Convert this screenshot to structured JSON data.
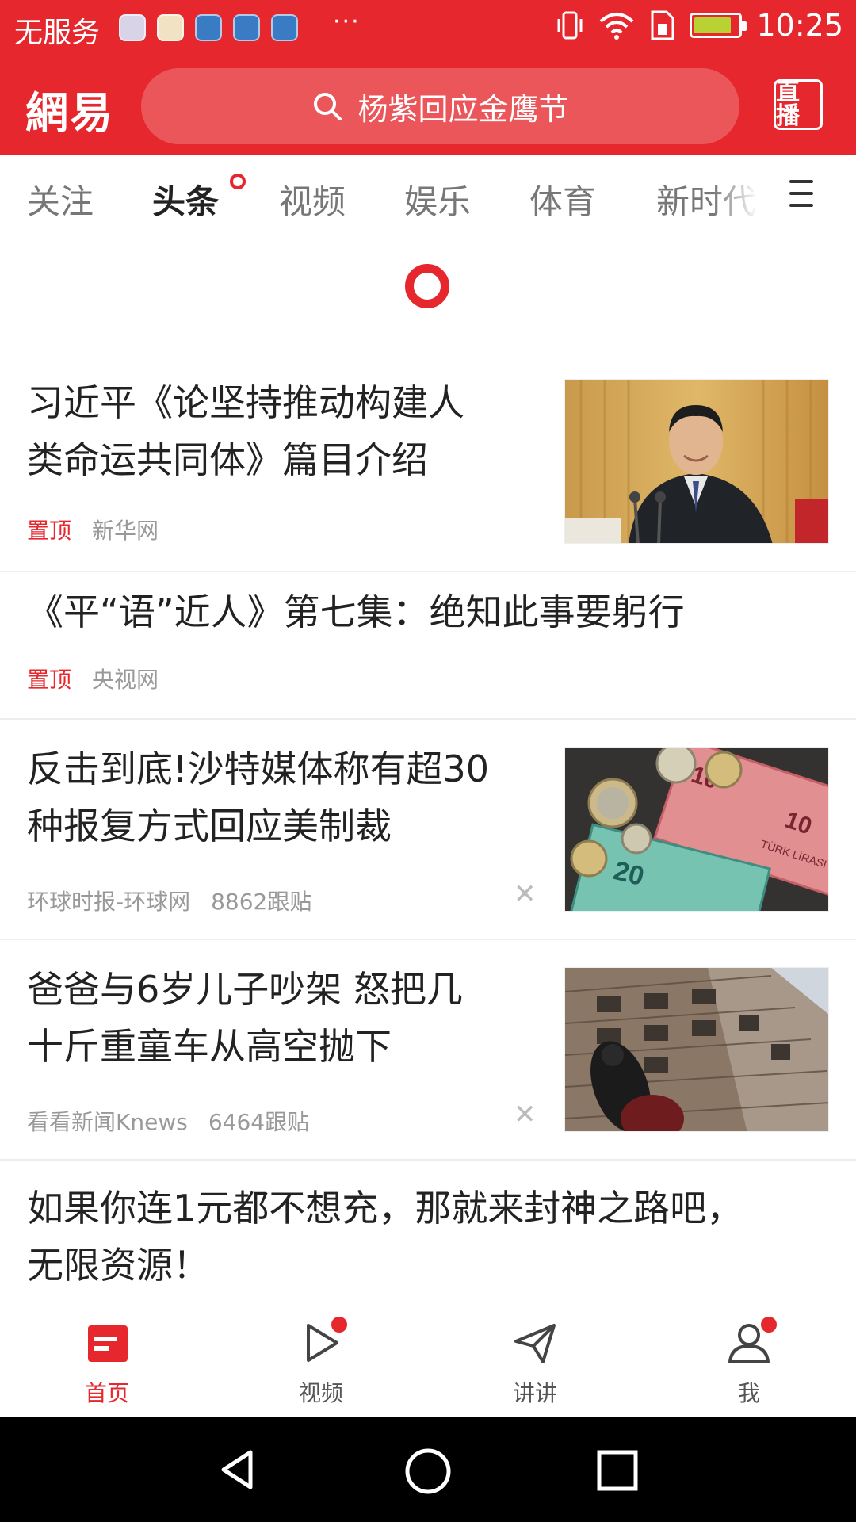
{
  "status_bar": {
    "carrier": "无服务",
    "more": "···",
    "time": "10:25",
    "battery_level": 0.85,
    "battery_color": "#b7d232"
  },
  "header": {
    "logo": "網易",
    "search_placeholder": "杨紫回应金鹰节",
    "live_label": "直播",
    "accent_color": "#e6272d"
  },
  "tabs": [
    {
      "label": "关注",
      "active": false
    },
    {
      "label": "头条",
      "active": true,
      "dot": true
    },
    {
      "label": "视频",
      "active": false
    },
    {
      "label": "娱乐",
      "active": false
    },
    {
      "label": "体育",
      "active": false
    },
    {
      "label": "新时代",
      "active": false
    }
  ],
  "feed": [
    {
      "title_lines": [
        "习近平《论坚持推动构建人",
        "类命运共同体》篇目介绍"
      ],
      "pin": "置顶",
      "source": "新华网",
      "thumb": "photo-speaker"
    },
    {
      "title_lines": [
        "《平“语”近人》第七集：绝知此事要躬行"
      ],
      "pin": "置顶",
      "source": "央视网"
    },
    {
      "title_lines": [
        "反击到底!沙特媒体称有超30",
        "种报复方式回应美制裁"
      ],
      "source": "环球时报-环球网",
      "comments": "8862跟贴",
      "thumb": "photo-currency",
      "close_icon": "close-icon"
    },
    {
      "title_lines": [
        "爸爸与6岁儿子吵架 怒把几",
        "十斤重童车从高空抛下"
      ],
      "source": "看看新闻Knews",
      "comments": "6464跟贴",
      "thumb": "photo-building",
      "close_icon": "close-icon"
    },
    {
      "title_lines": [
        "如果你连1元都不想充，那就来封神之路吧，",
        "无限资源！"
      ]
    }
  ],
  "bottom_nav": [
    {
      "label": "首页",
      "icon": "home-icon",
      "active": true
    },
    {
      "label": "视频",
      "icon": "video-icon",
      "badge": true
    },
    {
      "label": "讲讲",
      "icon": "send-icon"
    },
    {
      "label": "我",
      "icon": "user-icon",
      "badge": true
    }
  ],
  "system_nav": [
    "back-icon",
    "home-circle-icon",
    "recents-icon"
  ]
}
